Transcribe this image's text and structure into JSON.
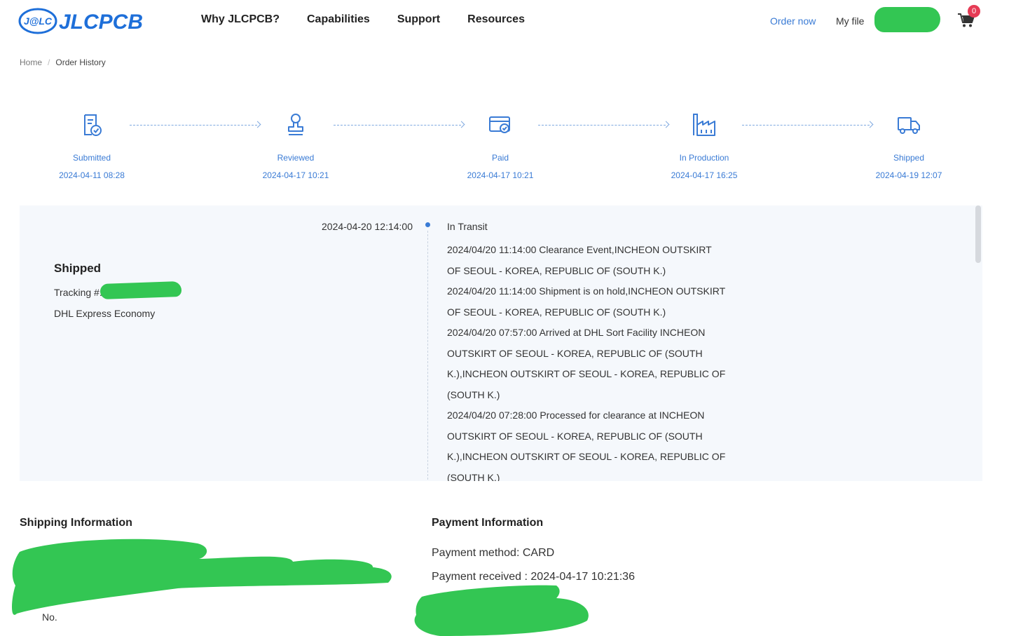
{
  "brand": {
    "name": "JLCPCB",
    "mark": "J@LC"
  },
  "nav": [
    {
      "label": "Why JLCPCB?"
    },
    {
      "label": "Capabilities"
    },
    {
      "label": "Support"
    },
    {
      "label": "Resources"
    }
  ],
  "header": {
    "order_now": "Order now",
    "my_file": "My file",
    "cart_count": "0"
  },
  "breadcrumb": {
    "home": "Home",
    "separator": "/",
    "current": "Order History"
  },
  "steps": [
    {
      "label": "Submitted",
      "date": "2024-04-11 08:28",
      "icon": "document-check-icon"
    },
    {
      "label": "Reviewed",
      "date": "2024-04-17 10:21",
      "icon": "stamp-icon"
    },
    {
      "label": "Paid",
      "date": "2024-04-17 10:21",
      "icon": "card-check-icon"
    },
    {
      "label": "In Production",
      "date": "2024-04-17 16:25",
      "icon": "factory-icon"
    },
    {
      "label": "Shipped",
      "date": "2024-04-19 12:07",
      "icon": "truck-icon"
    }
  ],
  "tracking": {
    "title": "Shipped",
    "tracking_label": "Tracking #:",
    "carrier": "DHL Express Economy",
    "latest_time": "2024-04-20 12:14:00",
    "latest_status": "In Transit",
    "events": [
      "2024/04/20 11:14:00 Clearance Event,INCHEON OUTSKIRT OF SEOUL - KOREA, REPUBLIC OF (SOUTH K.)",
      "2024/04/20 11:14:00 Shipment is on hold,INCHEON OUTSKIRT OF SEOUL - KOREA, REPUBLIC OF (SOUTH K.)",
      "2024/04/20 07:57:00 Arrived at DHL Sort Facility INCHEON OUTSKIRT OF SEOUL - KOREA, REPUBLIC OF (SOUTH K.),INCHEON OUTSKIRT OF SEOUL - KOREA, REPUBLIC OF (SOUTH K.)",
      "2024/04/20 07:28:00 Processed for clearance at INCHEON OUTSKIRT OF SEOUL - KOREA, REPUBLIC OF (SOUTH K.),INCHEON OUTSKIRT OF SEOUL - KOREA, REPUBLIC OF (SOUTH K.)"
    ]
  },
  "shipping": {
    "title": "Shipping Information",
    "stub": "No."
  },
  "payment": {
    "title": "Payment Information",
    "method": "Payment method: CARD",
    "received": "Payment received : 2024-04-17 10:21:36"
  },
  "colors": {
    "accent": "#3a7bd5",
    "redaction": "#33c653",
    "badge": "#e63b55",
    "panel": "#f5f8fc"
  }
}
